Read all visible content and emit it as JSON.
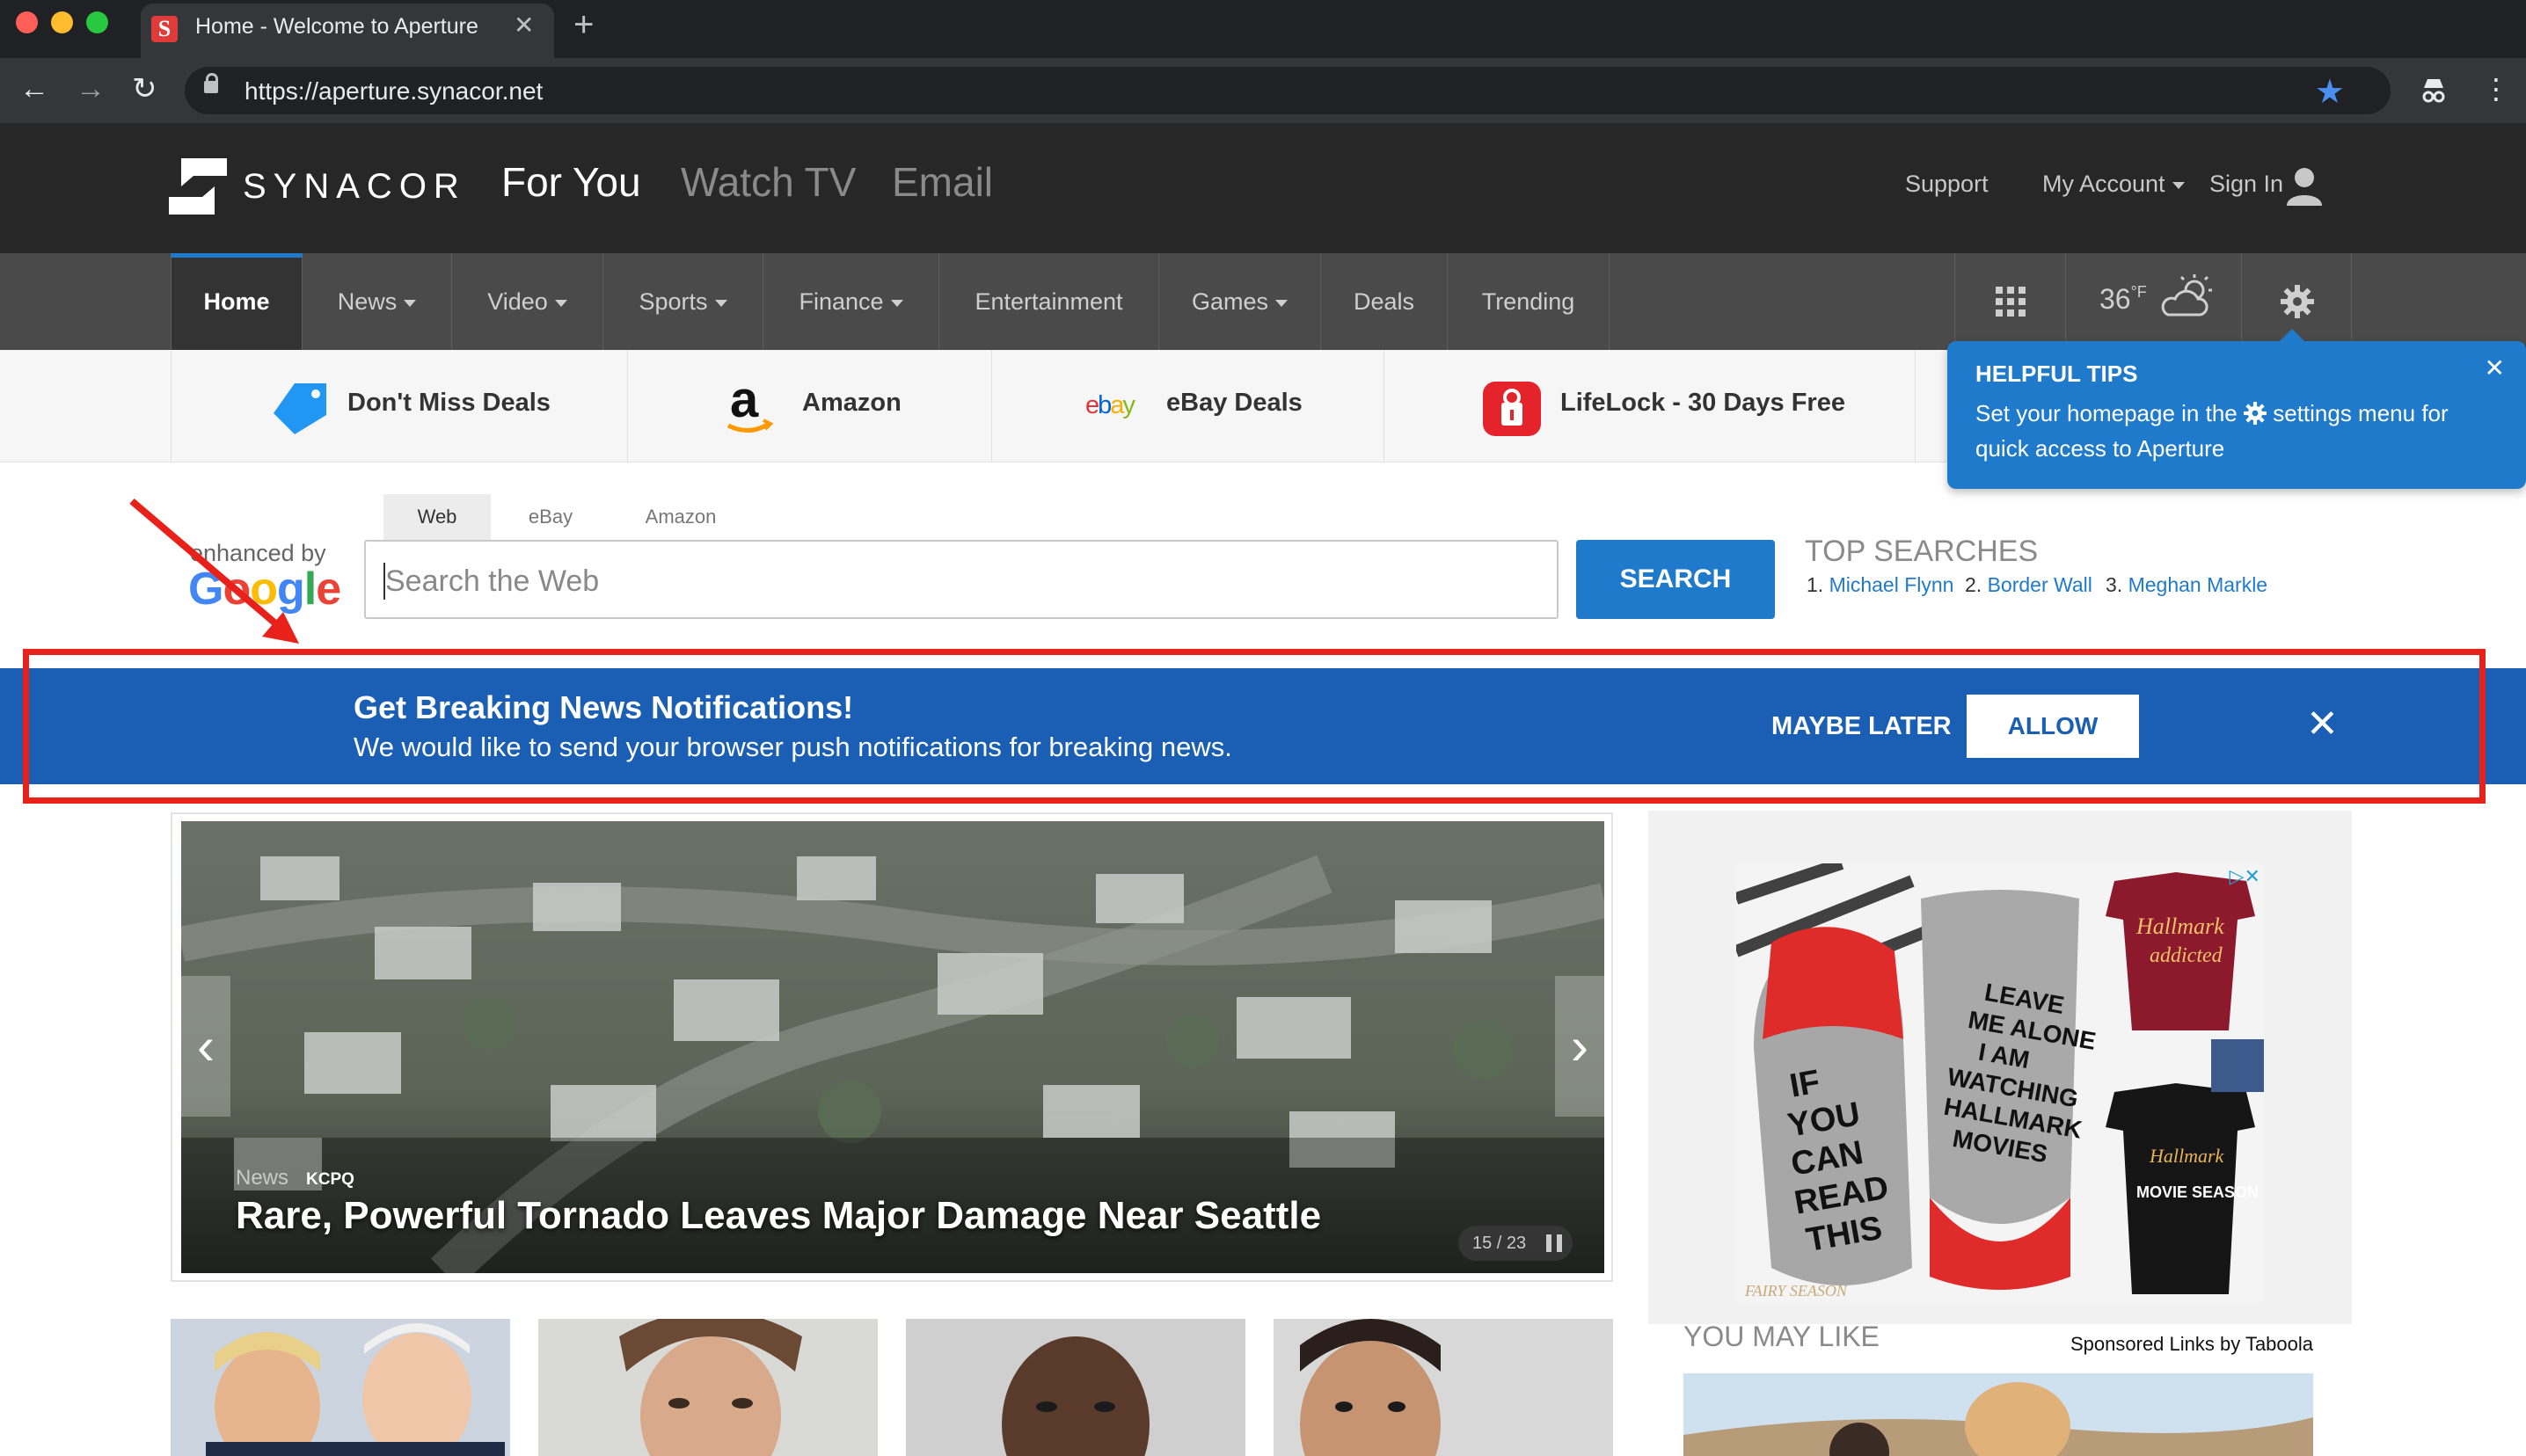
{
  "browser": {
    "tab_title": "Home - Welcome to Aperture",
    "favicon_letter": "S",
    "url": "https://aperture.synacor.net",
    "colors": {
      "close": "#ff5f57",
      "minimize": "#febc2e",
      "zoom": "#28c840"
    }
  },
  "header": {
    "logo_text": "SYNACOR",
    "top_nav": [
      "For You",
      "Watch TV",
      "Email"
    ],
    "support": "Support",
    "my_account": "My Account",
    "sign_in": "Sign In"
  },
  "main_nav": {
    "items": [
      "Home",
      "News",
      "Video",
      "Sports",
      "Finance",
      "Entertainment",
      "Games",
      "Deals",
      "Trending"
    ],
    "weather_temp": "36",
    "weather_unit": "°F"
  },
  "quick_links": [
    "Don't Miss Deals",
    "Amazon",
    "eBay Deals",
    "LifeLock - 30 Days Free"
  ],
  "tips": {
    "title": "HELPFUL TIPS",
    "body_before": "Set your homepage in the",
    "body_after": "settings menu for quick access to Aperture"
  },
  "search": {
    "enhanced_by": "enhanced by",
    "google": "Google",
    "tabs": [
      "Web",
      "eBay",
      "Amazon"
    ],
    "placeholder": "Search the Web",
    "button": "SEARCH",
    "top_searches_title": "TOP SEARCHES",
    "top_searches": [
      {
        "num": "1.",
        "label": "Michael Flynn"
      },
      {
        "num": "2.",
        "label": "Border Wall"
      },
      {
        "num": "3.",
        "label": "Meghan Markle"
      }
    ]
  },
  "notification": {
    "title": "Get Breaking News Notifications!",
    "body": "We would like to send your browser push notifications for breaking news.",
    "maybe_later": "MAYBE LATER",
    "allow": "ALLOW",
    "close": "✕"
  },
  "hero": {
    "category": "News",
    "source": "KCPQ",
    "title": "Rare, Powerful Tornado Leaves Major Damage Near Seattle",
    "counter": "15 / 23"
  },
  "ad": {
    "brand": "Hallmark",
    "sock_left": "IF YOU CAN READ THIS",
    "sock_right": "LEAVE ME ALONE I AM WATCHING HALLMARK MOVIES",
    "shirt_top": "addicted",
    "shirt_bottom": "MOVIE SEASON",
    "watermark": "FAIRY SEASON"
  },
  "you_may_like": {
    "title": "YOU MAY LIKE",
    "sponsored": "Sponsored Links by Taboola"
  }
}
